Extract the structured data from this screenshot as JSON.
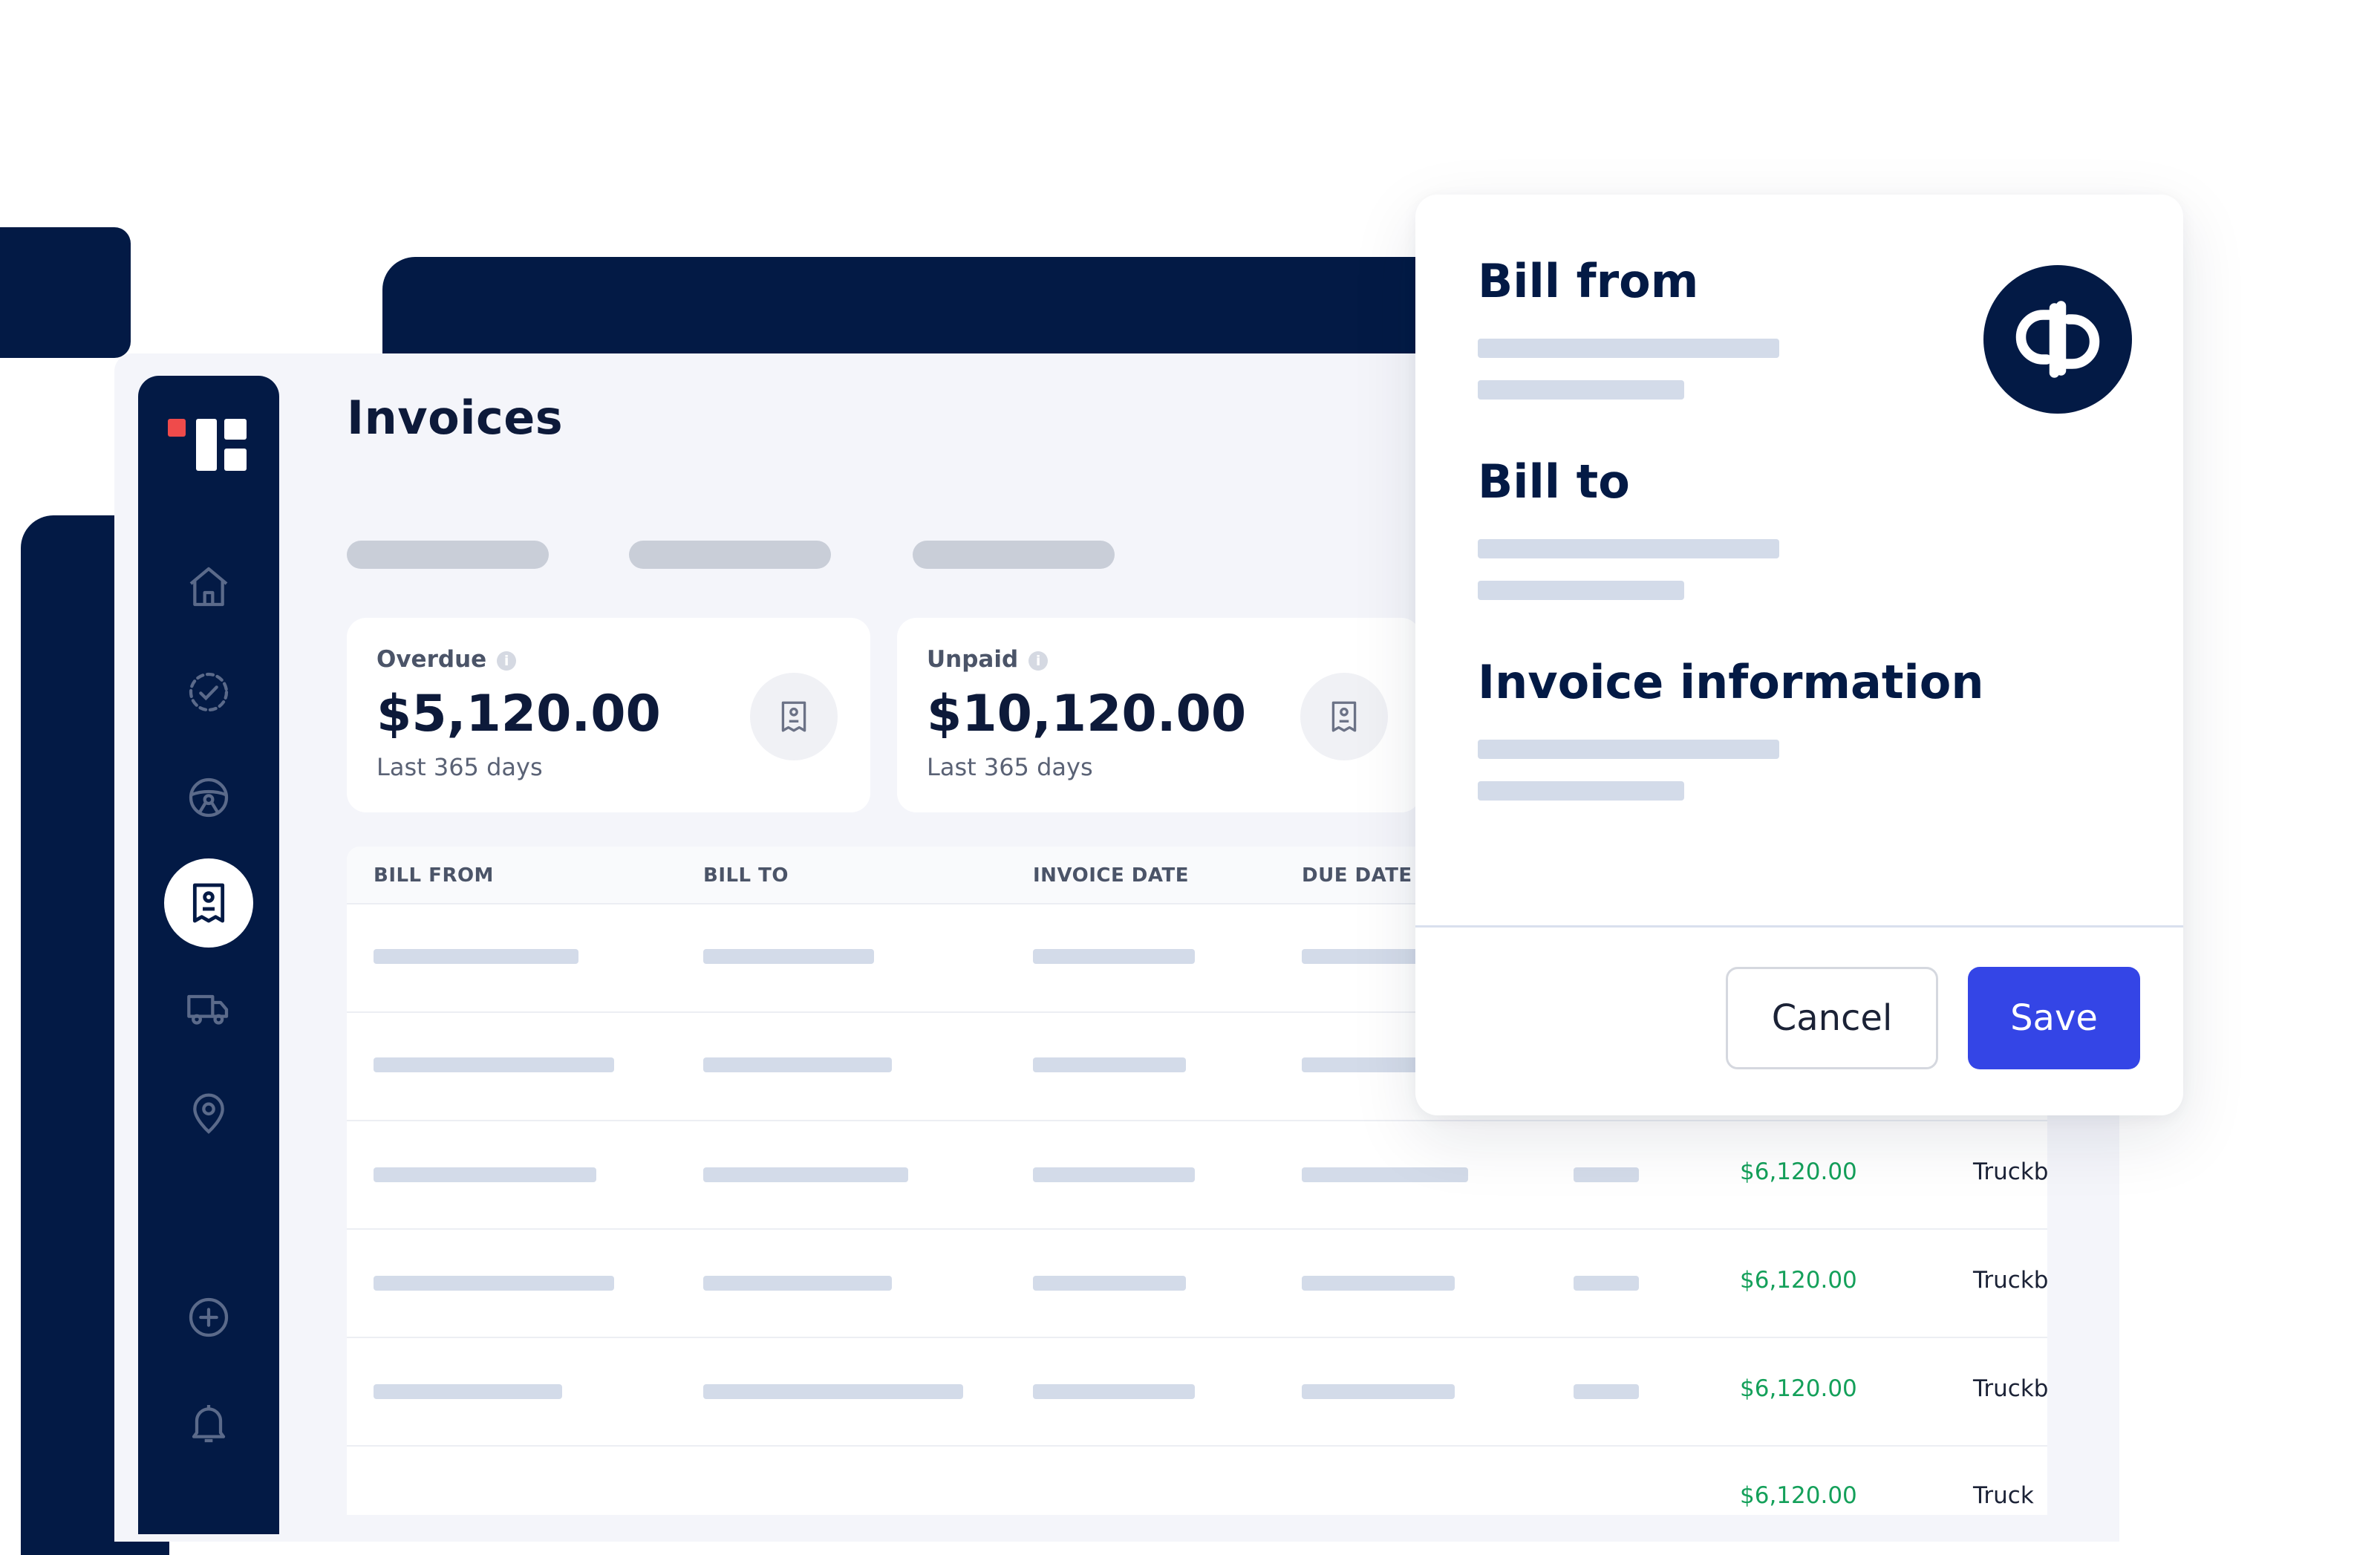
{
  "page": {
    "title": "Invoices"
  },
  "summary_cards": [
    {
      "label": "Overdue",
      "amount": "$5,120.00",
      "period": "Last 365 days",
      "icon": "receipt-icon"
    },
    {
      "label": "Unpaid",
      "amount": "$10,120.00",
      "period": "Last 365 days",
      "icon": "receipt-icon"
    }
  ],
  "info_glyph": "i",
  "table": {
    "columns": [
      "BILL FROM",
      "BILL TO",
      "INVOICE DATE",
      "DUE DATE"
    ],
    "rows": [
      {
        "amount": "",
        "carrier": ""
      },
      {
        "amount": "",
        "carrier": ""
      },
      {
        "amount": "$6,120.00",
        "carrier": "Truckb"
      },
      {
        "amount": "$6,120.00",
        "carrier": "Truckb"
      },
      {
        "amount": "$6,120.00",
        "carrier": "Truckb"
      },
      {
        "amount": "$6,120.00",
        "carrier": "Truck"
      }
    ]
  },
  "sidebar": {
    "icons": [
      "home-icon",
      "tasks-check-icon",
      "steering-wheel-icon",
      "invoice-receipt-icon",
      "truck-icon",
      "location-pin-icon",
      "add-circle-icon",
      "bell-icon"
    ],
    "active": "invoice-receipt-icon",
    "brand_colors": {
      "red": "#ef4b4b",
      "navy": "#031a45"
    }
  },
  "modal": {
    "sections": [
      "Bill from",
      "Bill to",
      "Invoice information"
    ],
    "logo": "quickbooks-logo",
    "cancel_label": "Cancel",
    "save_label": "Save",
    "save_color": "#3445e6"
  },
  "colors": {
    "amount_green": "#14a05a",
    "background": "#f4f5fa"
  }
}
